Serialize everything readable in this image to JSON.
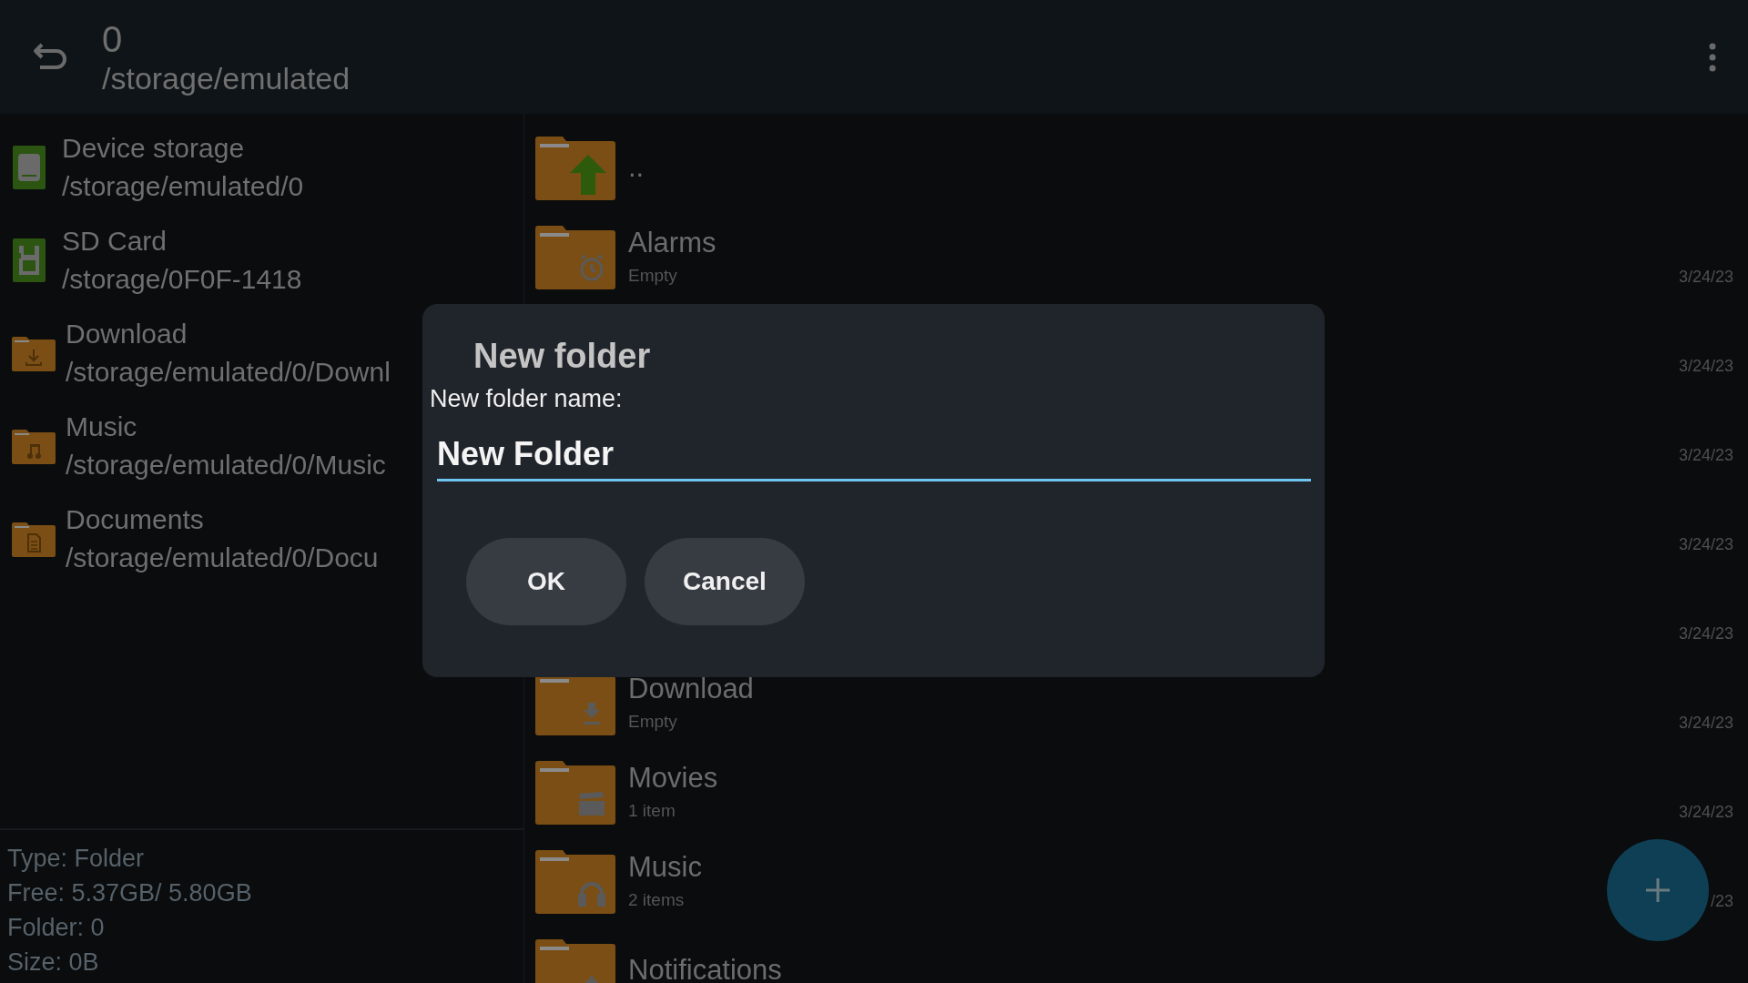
{
  "header": {
    "title": "0",
    "path": "/storage/emulated"
  },
  "sidebar": {
    "items": [
      {
        "kind": "storage",
        "name": "Device storage",
        "path": "/storage/emulated/0"
      },
      {
        "kind": "sdcard",
        "name": "SD Card",
        "path": "/storage/0F0F-1418"
      },
      {
        "kind": "download",
        "name": "Download",
        "path": "/storage/emulated/0/Downl"
      },
      {
        "kind": "music",
        "name": "Music",
        "path": "/storage/emulated/0/Music"
      },
      {
        "kind": "document",
        "name": "Documents",
        "path": "/storage/emulated/0/Docu"
      }
    ],
    "info": [
      "Type: Folder",
      "Free: 5.37GB/ 5.80GB",
      "Folder: 0",
      "Size: 0B"
    ]
  },
  "files": [
    {
      "kind": "up",
      "name": ".."
    },
    {
      "kind": "alarm",
      "name": "Alarms",
      "detail": "Empty",
      "date": "3/24/23"
    },
    {
      "date": "3/24/23"
    },
    {
      "date": "3/24/23"
    },
    {
      "date": "3/24/23"
    },
    {
      "date": "3/24/23"
    },
    {
      "kind": "download",
      "name": "Download",
      "detail": "Empty",
      "date": "3/24/23"
    },
    {
      "kind": "movie",
      "name": "Movies",
      "detail": "1 item",
      "date": "3/24/23"
    },
    {
      "kind": "music",
      "name": "Music",
      "detail": "2 items",
      "date": "/23"
    },
    {
      "kind": "bell",
      "name": "Notifications"
    }
  ],
  "dialog": {
    "title": "New folder",
    "label": "New folder name:",
    "value": "New Folder",
    "buttons": [
      "OK",
      "Cancel"
    ]
  }
}
